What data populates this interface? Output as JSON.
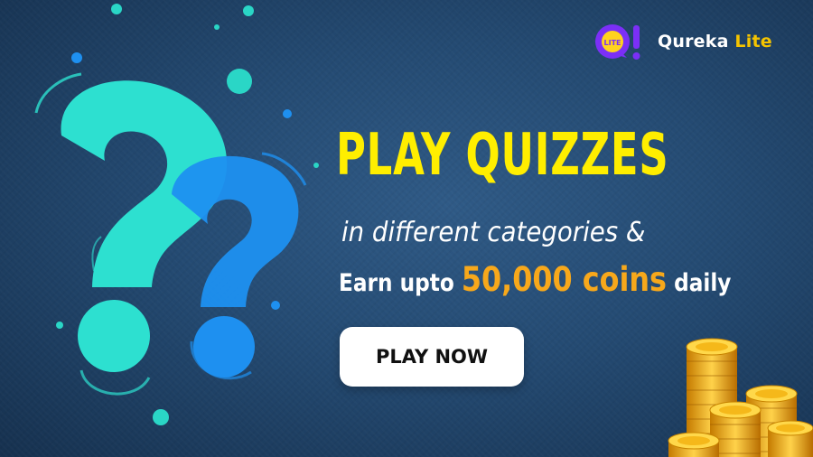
{
  "brand": {
    "name_main": "Qureka",
    "name_accent": "Lite",
    "logo_badge": "LITE",
    "logo_glyph": "Q!",
    "accent_color": "#f5c400",
    "logo_color": "#7b2ff7"
  },
  "headline": "PLAY QUIZZES",
  "subline": "in different categories &",
  "earn": {
    "prefix": "Earn upto",
    "highlight": "50,000 coins",
    "suffix": "daily"
  },
  "cta": {
    "label": "PLAY NOW"
  },
  "colors": {
    "headline": "#ffee00",
    "highlight": "#f7a81b",
    "qmark_teal": "#2de0d0",
    "qmark_blue": "#1e90f0",
    "background": "#244a72"
  },
  "icons": [
    "question-mark-icon",
    "coin-stack-icon"
  ]
}
